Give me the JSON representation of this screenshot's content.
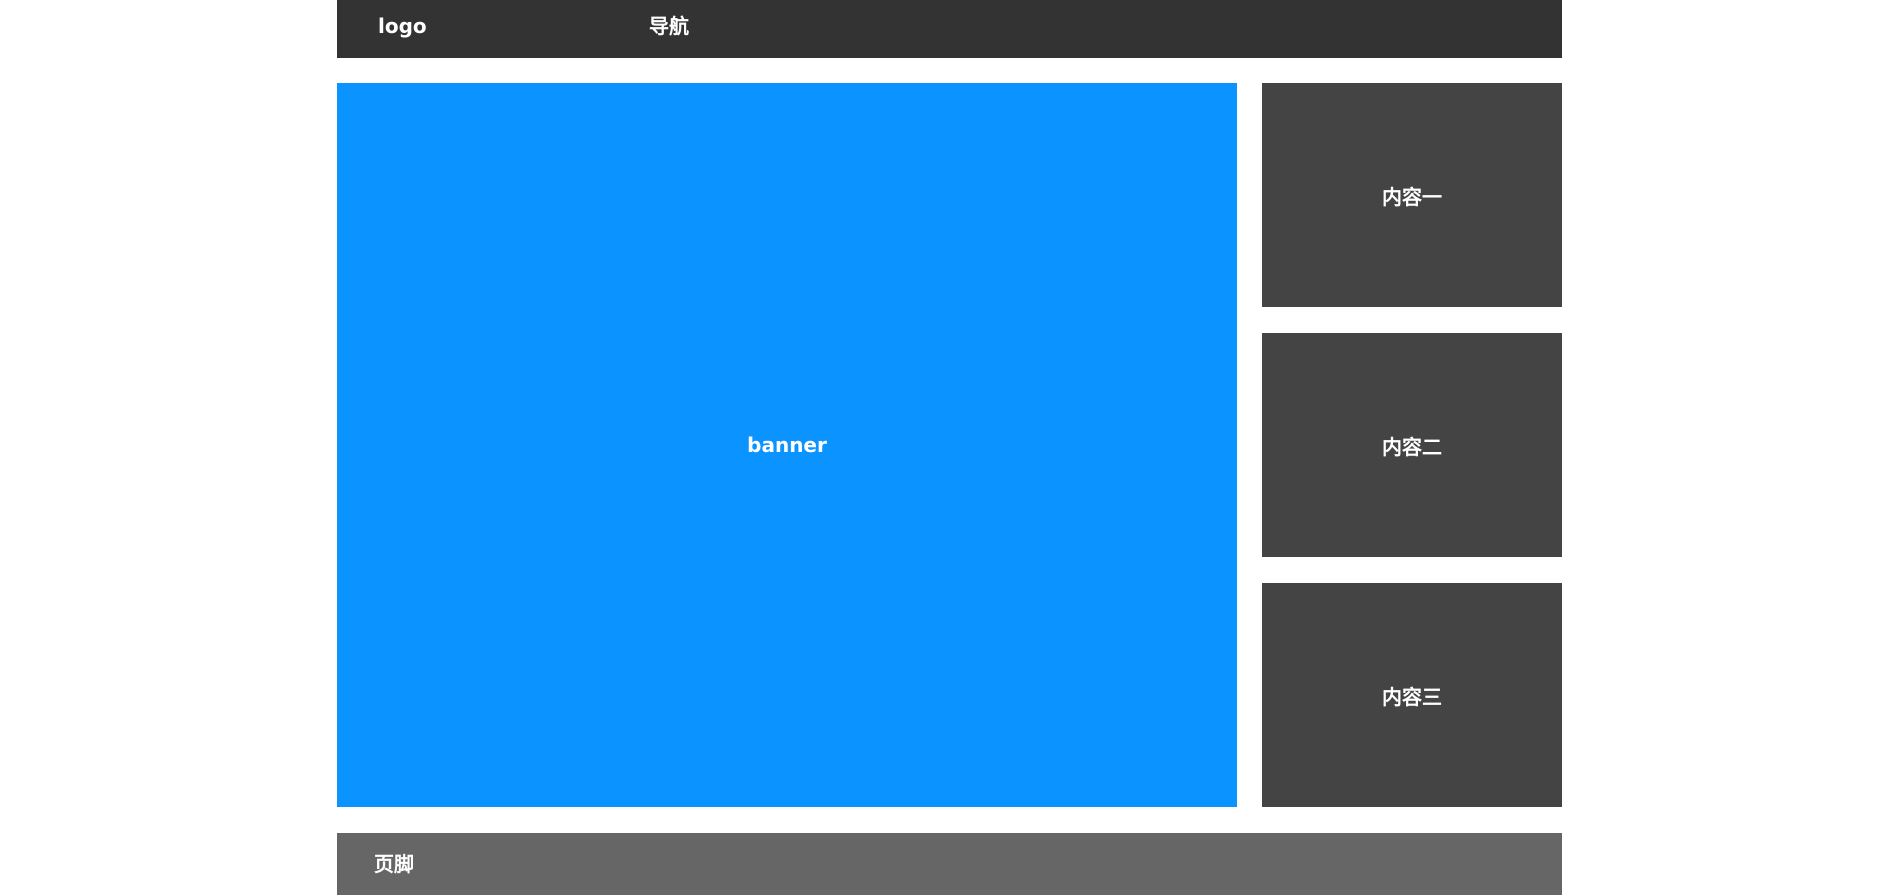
{
  "header": {
    "logo_text": "logo",
    "nav_text": "导航"
  },
  "banner": {
    "label": "banner"
  },
  "content": {
    "items": [
      {
        "label": "内容一"
      },
      {
        "label": "内容二"
      },
      {
        "label": "内容三"
      }
    ]
  },
  "footer": {
    "label": "页脚"
  },
  "colors": {
    "header_bg": "#333333",
    "banner_bg": "#0b94ff",
    "content_bg": "#444444",
    "footer_bg": "#666666",
    "text": "#ffffff"
  }
}
